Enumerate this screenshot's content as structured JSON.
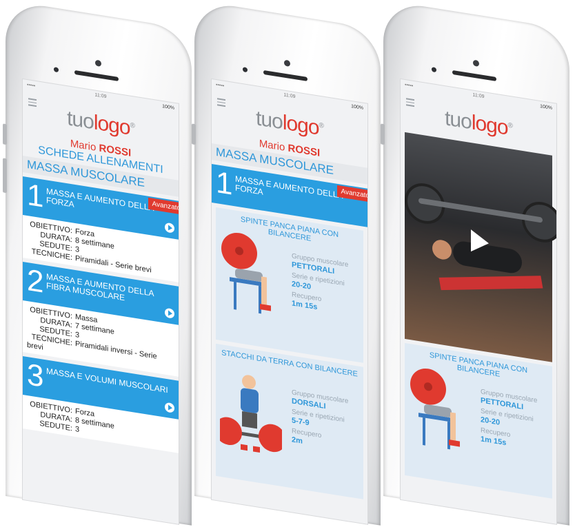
{
  "status": {
    "carrier": "•••••",
    "time": "11:09",
    "battery": "100%"
  },
  "logo": {
    "tuo": "tuo",
    "logo": "logo",
    "reg": "®"
  },
  "user": {
    "first_name": "Mario",
    "last_name": "ROSSI"
  },
  "phone1": {
    "section_title": "SCHEDE ALLENAMENTI",
    "heading": "MASSA MUSCOLARE",
    "plans": [
      {
        "number": "1",
        "name": "MASSA E AUMENTO DELLA FORZA",
        "badge": "Avanzato",
        "rows": [
          {
            "label": "OBIETTIVO:",
            "value": "Forza"
          },
          {
            "label": "DURATA:",
            "value": "8 settimane"
          },
          {
            "label": "SEDUTE:",
            "value": "3"
          },
          {
            "label": "TECNICHE:",
            "value": "Piramidali - Serie brevi"
          }
        ]
      },
      {
        "number": "2",
        "name": "MASSA E AUMENTO DELLA FIBRA MUSCOLARE",
        "rows": [
          {
            "label": "OBIETTIVO:",
            "value": "Massa"
          },
          {
            "label": "DURATA:",
            "value": "7 settimane"
          },
          {
            "label": "SEDUTE:",
            "value": "3"
          },
          {
            "label": "TECNICHE:",
            "value": "Piramidali inversi - Serie brevi"
          }
        ]
      },
      {
        "number": "3",
        "name": "MASSA E VOLUMI MUSCOLARI",
        "rows": [
          {
            "label": "OBIETTIVO:",
            "value": "Forza"
          },
          {
            "label": "DURATA:",
            "value": "8 settimane"
          },
          {
            "label": "SEDUTE:",
            "value": "3"
          }
        ]
      }
    ]
  },
  "phone2": {
    "heading": "MASSA MUSCOLARE",
    "plan": {
      "number": "1",
      "name": "MASSA E AUMENTO DELLA FORZA",
      "badge": "Avanzato"
    },
    "exercises": [
      {
        "title": "SPINTE PANCA PIANA CON BILANCERE",
        "group_label": "Gruppo muscolare",
        "group": "PETTORALI",
        "reps_label": "Serie e ripetizioni",
        "reps": "20-20",
        "rest_label": "Recupero",
        "rest": "1m 15s"
      },
      {
        "title": "STACCHI DA TERRA CON BILANCERE",
        "group_label": "Gruppo muscolare",
        "group": "DORSALI",
        "reps_label": "Serie e ripetizioni",
        "reps": "5-7-9",
        "rest_label": "Recupero",
        "rest": "2m"
      }
    ]
  },
  "phone3": {
    "exercise": {
      "title": "SPINTE PANCA PIANA CON BILANCERE",
      "group_label": "Gruppo muscolare",
      "group": "PETTORALI",
      "reps_label": "Serie e ripetizioni",
      "reps": "20-20",
      "rest_label": "Recupero",
      "rest": "1m 15s"
    }
  },
  "colors": {
    "accent_blue": "#2a9ee0",
    "brand_red": "#e03a2f",
    "label_grey": "#9aa7b3"
  },
  "icons": [
    "menu-icon",
    "play-icon",
    "signal-icon",
    "battery-icon",
    "bench-press-illustration",
    "deadlift-illustration",
    "video-play-icon"
  ]
}
